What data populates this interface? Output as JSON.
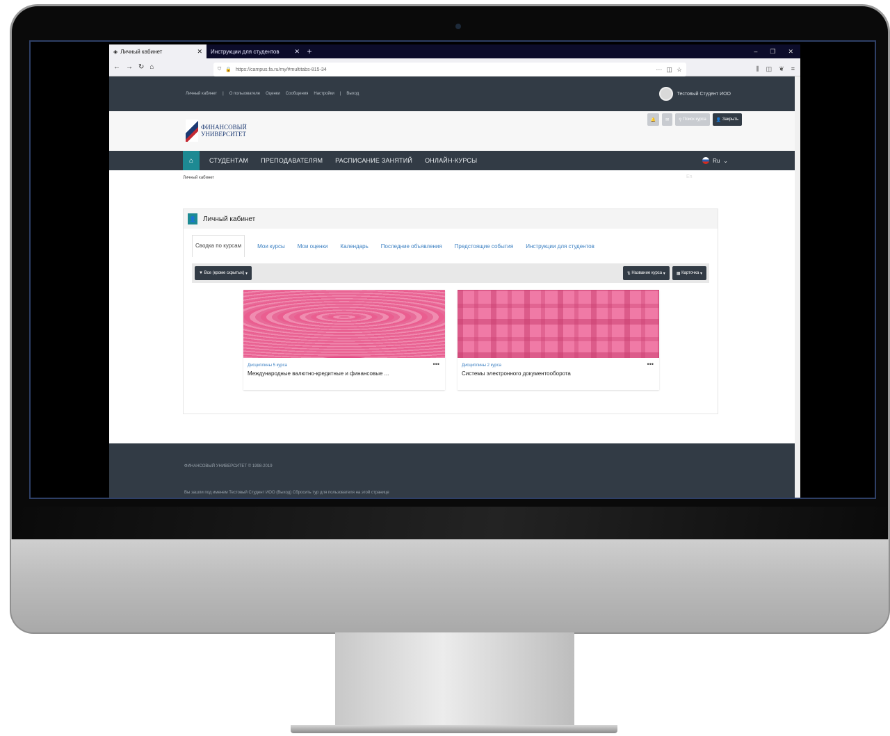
{
  "browser": {
    "tabs": [
      {
        "label": "Личный кабинет",
        "active": true
      },
      {
        "label": "Инструкции для студентов",
        "active": false
      }
    ],
    "new_tab": "+",
    "url": "https://campus.fa.ru/my/#multitabs-815-34",
    "window_controls": [
      "‒",
      "❐",
      "✕"
    ]
  },
  "site": {
    "top_links": [
      "Личный кабинет",
      "О пользователе",
      "Оценки",
      "Сообщения",
      "Настройки",
      "Выход"
    ],
    "user_name": "Тестовый Студент ИОО",
    "logo_line1": "ФИНАНСОВЫЙ",
    "logo_line2": "УНИВЕРСИТЕТ",
    "header_buttons": {
      "search": "Поиск курса",
      "close": "Закрыть"
    },
    "nav": [
      "СТУДЕНТАМ",
      "ПРЕПОДАВАТЕЛЯМ",
      "РАСПИСАНИЕ ЗАНЯТИЙ",
      "ОНЛАЙН-КУРСЫ"
    ],
    "lang": "Ru",
    "lang_alt": "En",
    "breadcrumb": "Личный кабинет"
  },
  "panel": {
    "title": "Личный кабинет",
    "tabs": [
      "Сводка по курсам",
      "Мои курсы",
      "Мои оценки",
      "Календарь",
      "Последние объявления",
      "Предстоящие события",
      "Инструкции для студентов"
    ],
    "filter_label": "Все (кроме скрытых)",
    "sort_label": "Название курса",
    "view_label": "Карточка"
  },
  "courses": [
    {
      "category": "Дисциплины 5 курса",
      "title": "Международные валютно-кредитные и финансовые ..."
    },
    {
      "category": "Дисциплины 2 курса",
      "title": "Системы электронного документооборота"
    }
  ],
  "footer": {
    "copyright": "ФИНАНСОВЫЙ УНИВЕРСИТЕТ © 1998-2019",
    "login_info": "Вы зашли под именем Тестовый Студент ИОО (Выход)  Сбросить тур для пользователя на этой странице"
  }
}
